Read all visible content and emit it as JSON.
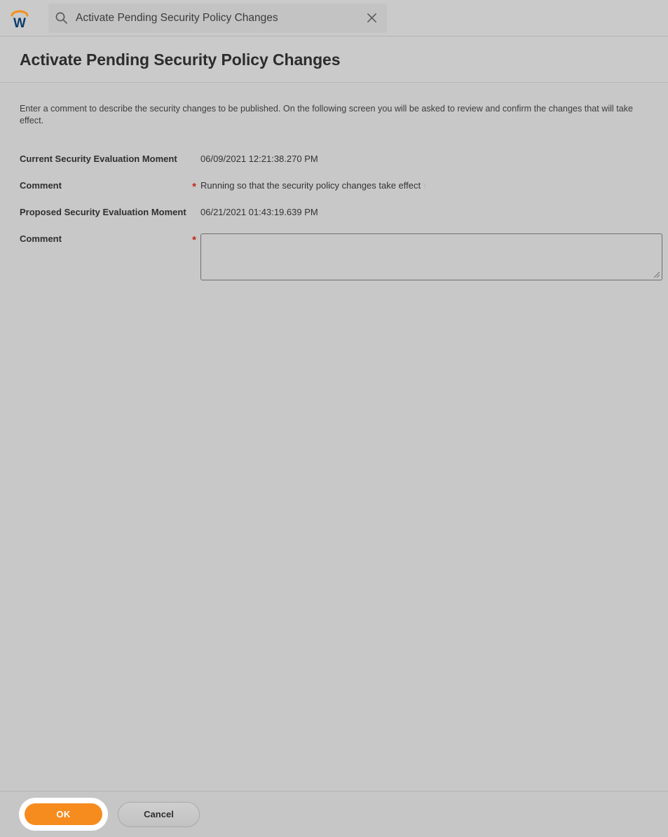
{
  "appbar": {
    "logo_name": "workday-logo",
    "logo_arc_color": "#f4911e",
    "logo_w_color": "#0b3d6e",
    "search": {
      "value": "Activate Pending Security Policy Changes",
      "placeholder": "Search",
      "search_icon": "search-icon",
      "clear_icon": "close-icon"
    }
  },
  "task": {
    "title": "Activate Pending Security Policy Changes",
    "instructions": "Enter a comment to describe the security changes to be published. On the following screen you will be asked to review and confirm the changes that will take effect."
  },
  "form": {
    "rows": [
      {
        "label": "Current Security Evaluation Moment",
        "required": "",
        "value": "06/09/2021 12:21:38.270 PM"
      },
      {
        "label": "Comment",
        "required": "*",
        "value": "Running so that the security policy changes take effect",
        "trailing": "\\"
      },
      {
        "label": "Proposed Security Evaluation Moment",
        "required": "",
        "value": "06/21/2021 01:43:19.639 PM"
      },
      {
        "label": "Comment",
        "required": "*",
        "value": "",
        "placeholder": ""
      }
    ]
  },
  "footer": {
    "ok_label": "OK",
    "cancel_label": "Cancel",
    "ok_color": "#f68c1e"
  }
}
